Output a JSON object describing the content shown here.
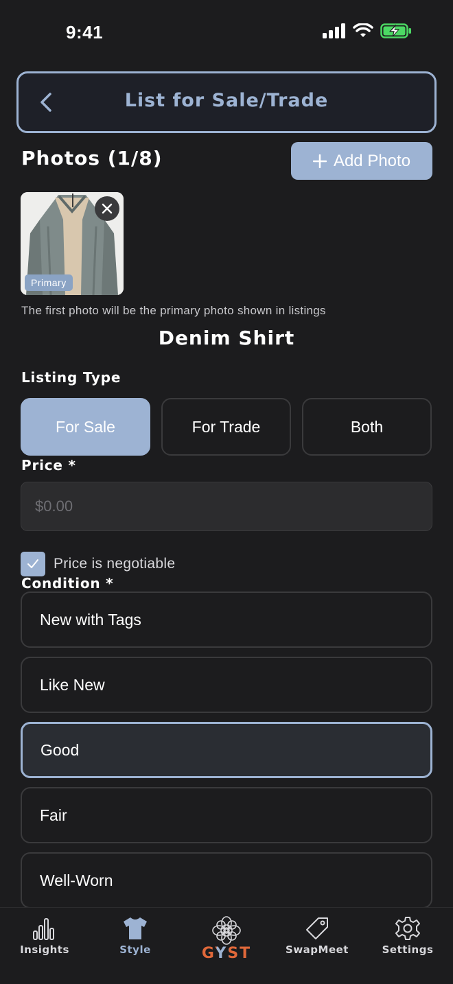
{
  "status_bar": {
    "time": "9:41"
  },
  "header": {
    "title": "List for Sale/Trade"
  },
  "photos": {
    "title": "Photos (1/8)",
    "add_label": "Add Photo",
    "primary_badge": "Primary",
    "hint": "The first photo will be the primary photo shown in listings"
  },
  "item": {
    "name": "Denim Shirt"
  },
  "listing_type": {
    "label": "Listing Type",
    "options": [
      "For Sale",
      "For Trade",
      "Both"
    ],
    "selected": "For Sale"
  },
  "price": {
    "label": "Price *",
    "placeholder": "$0.00",
    "negotiable_label": "Price is negotiable",
    "negotiable_checked": true
  },
  "condition": {
    "label": "Condition *",
    "options": [
      "New with Tags",
      "Like New",
      "Good",
      "Fair",
      "Well-Worn"
    ],
    "selected": "Good"
  },
  "tab_bar": {
    "tabs": [
      {
        "label": "Insights",
        "icon": "bar-chart-icon"
      },
      {
        "label": "Style",
        "icon": "tshirt-icon"
      },
      {
        "label": "GYST",
        "icon": "gyst-logo-icon"
      },
      {
        "label": "SwapMeet",
        "icon": "tag-icon"
      },
      {
        "label": "Settings",
        "icon": "gear-icon"
      }
    ],
    "active": "Style"
  },
  "colors": {
    "accent": "#9db3d3",
    "background": "#1c1c1e",
    "battery": "#4cd964",
    "gyst_orange": "#e0683a"
  }
}
